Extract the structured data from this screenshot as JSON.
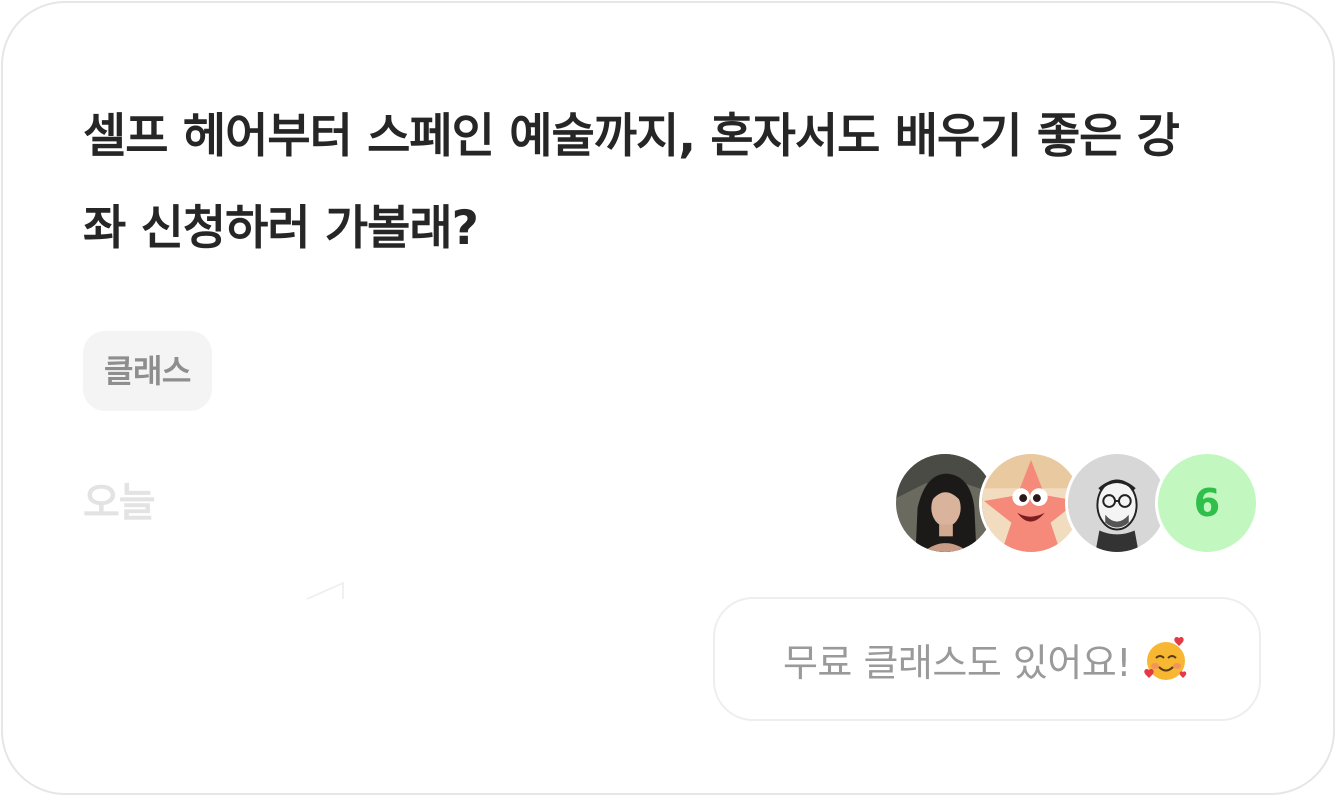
{
  "card": {
    "title": "셀프 헤어부터 스페인 예술까지, 혼자서도 배우기 좋은 강좌 신청하러 가볼래?",
    "tag": "클래스",
    "date": "오늘",
    "participants": {
      "avatars": [
        "person-photo",
        "patrick-star",
        "glasses-man-sketch"
      ],
      "count": "6"
    },
    "message": "무료 클래스도 있어요!",
    "emoji": "smiling-face-with-hearts"
  },
  "colors": {
    "title": "#262626",
    "tag_bg": "#f4f4f4",
    "tag_text": "#8e8e8e",
    "date": "#e3e3e3",
    "count_bg": "#c2f8c0",
    "count_text": "#2fbf4a",
    "bubble_text": "#9a9a9a"
  }
}
